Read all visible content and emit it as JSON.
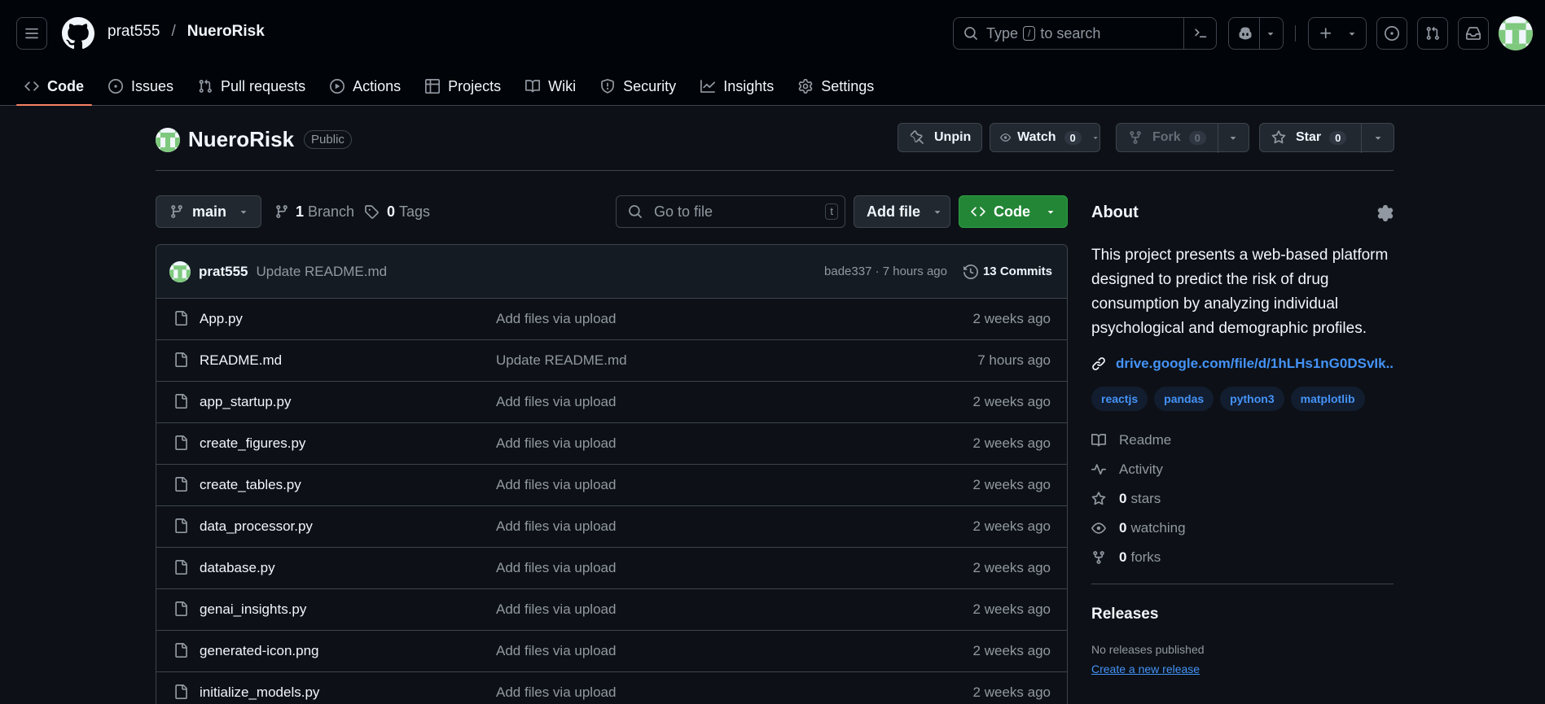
{
  "header": {
    "owner": "prat555",
    "separator": "/",
    "repo": "NueroRisk",
    "search": {
      "prefix": "Type",
      "key": "/",
      "suffix": "to search"
    }
  },
  "nav": [
    {
      "label": "Code",
      "icon": "code-icon",
      "active": true
    },
    {
      "label": "Issues",
      "icon": "issue-icon"
    },
    {
      "label": "Pull requests",
      "icon": "pull-request-icon"
    },
    {
      "label": "Actions",
      "icon": "play-icon"
    },
    {
      "label": "Projects",
      "icon": "table-icon"
    },
    {
      "label": "Wiki",
      "icon": "book-icon"
    },
    {
      "label": "Security",
      "icon": "shield-icon"
    },
    {
      "label": "Insights",
      "icon": "graph-icon"
    },
    {
      "label": "Settings",
      "icon": "gear-icon"
    }
  ],
  "repo_header": {
    "name": "NueroRisk",
    "visibility": "Public",
    "unpin": "Unpin",
    "watch": "Watch",
    "watch_count": "0",
    "fork": "Fork",
    "fork_count": "0",
    "star": "Star",
    "star_count": "0"
  },
  "toolbar": {
    "branch": "main",
    "branches": "1",
    "branches_label": "Branch",
    "tags": "0",
    "tags_label": "Tags",
    "go_to_file": "Go to file",
    "go_to_file_key": "t",
    "add_file": "Add file",
    "code": "Code"
  },
  "commit": {
    "author": "prat555",
    "message": "Update README.md",
    "hash_time": "bade337 · 7 hours ago",
    "commits": "13 Commits"
  },
  "files": [
    {
      "name": "App.py",
      "message": "Add files via upload",
      "date": "2 weeks ago"
    },
    {
      "name": "README.md",
      "message": "Update README.md",
      "date": "7 hours ago"
    },
    {
      "name": "app_startup.py",
      "message": "Add files via upload",
      "date": "2 weeks ago"
    },
    {
      "name": "create_figures.py",
      "message": "Add files via upload",
      "date": "2 weeks ago"
    },
    {
      "name": "create_tables.py",
      "message": "Add files via upload",
      "date": "2 weeks ago"
    },
    {
      "name": "data_processor.py",
      "message": "Add files via upload",
      "date": "2 weeks ago"
    },
    {
      "name": "database.py",
      "message": "Add files via upload",
      "date": "2 weeks ago"
    },
    {
      "name": "genai_insights.py",
      "message": "Add files via upload",
      "date": "2 weeks ago"
    },
    {
      "name": "generated-icon.png",
      "message": "Add files via upload",
      "date": "2 weeks ago"
    },
    {
      "name": "initialize_models.py",
      "message": "Add files via upload",
      "date": "2 weeks ago"
    }
  ],
  "about": {
    "title": "About",
    "description": "This project presents a web-based platform designed to predict the risk of drug consumption by analyzing individual psychological and demographic profiles.",
    "link": "drive.google.com/file/d/1hLHs1nG0DSvIk...",
    "topics": [
      "reactjs",
      "pandas",
      "python3",
      "matplotlib"
    ],
    "readme": "Readme",
    "activity": "Activity",
    "stars_count": "0",
    "stars_label": "stars",
    "watching_count": "0",
    "watching_label": "watching",
    "forks_count": "0",
    "forks_label": "forks"
  },
  "releases": {
    "title": "Releases",
    "none": "No releases published",
    "create": "Create a new release"
  },
  "colors": {
    "background": "#0d1117",
    "header": "#010409",
    "accent_green": "#238636",
    "link_blue": "#4493f8",
    "active_tab": "#f78166"
  }
}
